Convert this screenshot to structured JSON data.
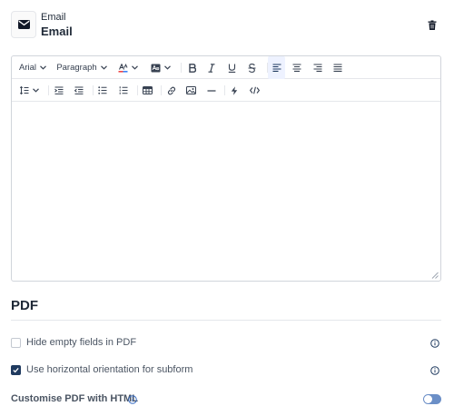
{
  "header": {
    "type_label": "Email",
    "field_label": "Email",
    "type_icon": "envelope-icon",
    "delete_icon": "trash-icon"
  },
  "editor": {
    "font_family": "Arial",
    "block_format": "Paragraph",
    "toolbar_row1_icons": [
      "text-color-icon",
      "highlight-icon",
      "bold-icon",
      "italic-icon",
      "underline-icon",
      "strikethrough-icon",
      "align-left-icon",
      "align-center-icon",
      "align-right-icon",
      "align-justify-icon"
    ],
    "toolbar_row2_icons": [
      "line-height-icon",
      "indent-icon",
      "outdent-icon",
      "bullet-list-icon",
      "numbered-list-icon",
      "table-icon",
      "link-icon",
      "image-icon",
      "horizontal-rule-icon",
      "lightning-icon",
      "code-view-icon"
    ],
    "content": "",
    "active_alignment": "left"
  },
  "pdf": {
    "title": "PDF",
    "options": [
      {
        "label": "Hide empty fields in PDF",
        "checked": false
      },
      {
        "label": "Use horizontal orientation for subform",
        "checked": true
      }
    ],
    "customise_label": "Customise PDF with HTML",
    "customise_enabled": false
  },
  "colors": {
    "accent": "#1f3a5f",
    "toggle": "#6b8fc7",
    "text_color_underline": "#ef4444",
    "text_color_underline_2": "#3b82f6",
    "border": "#d1d5db"
  }
}
